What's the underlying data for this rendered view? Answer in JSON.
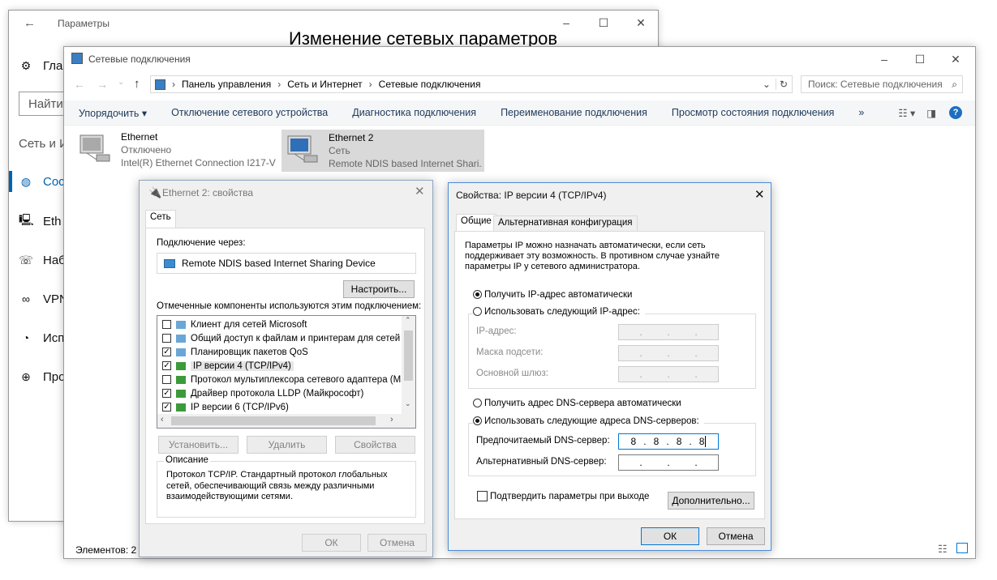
{
  "settings": {
    "title": "Параметры",
    "heading": "Изменение сетевых параметров",
    "home_label": "Гла",
    "search_placeholder": "Найти",
    "section": "Сеть и И",
    "items": [
      {
        "label": "Сос",
        "icon": "globe-icon",
        "active": true
      },
      {
        "label": "Eth",
        "icon": "ethernet-icon"
      },
      {
        "label": "Наб",
        "icon": "dialup-icon"
      },
      {
        "label": "VPN",
        "icon": "vpn-icon"
      },
      {
        "label": "Исп",
        "icon": "data-usage-icon"
      },
      {
        "label": "Про",
        "icon": "proxy-icon"
      }
    ]
  },
  "netconn": {
    "title": "Сетевые подключения",
    "breadcrumb": [
      "Панель управления",
      "Сеть и Интернет",
      "Сетевые подключения"
    ],
    "search_placeholder": "Поиск: Сетевые подключения",
    "commands": [
      "Упорядочить ▾",
      "Отключение сетевого устройства",
      "Диагностика подключения",
      "Переименование подключения",
      "Просмотр состояния подключения",
      "»"
    ],
    "adapters": [
      {
        "name": "Ethernet",
        "status": "Отключено",
        "device": "Intel(R) Ethernet Connection I217-V",
        "selected": false
      },
      {
        "name": "Ethernet 2",
        "status": "Сеть",
        "device": "Remote NDIS based Internet Shari...",
        "selected": true
      }
    ],
    "status_bar": "Элементов: 2"
  },
  "props": {
    "title": "Ethernet 2: свойства",
    "tab": "Сеть",
    "connect_via_label": "Подключение через:",
    "device": "Remote NDIS based Internet Sharing Device",
    "configure_button": "Настроить...",
    "components_label": "Отмеченные компоненты используются этим подключением:",
    "components": [
      {
        "label": "Клиент для сетей Microsoft",
        "checked": false
      },
      {
        "label": "Общий доступ к файлам и принтерам для сетей Mi",
        "checked": false
      },
      {
        "label": "Планировщик пакетов QoS",
        "checked": true
      },
      {
        "label": "IP версии 4 (TCP/IPv4)",
        "checked": true,
        "selected": true
      },
      {
        "label": "Протокол мультиплексора сетевого адаптера (Май",
        "checked": false
      },
      {
        "label": "Драйвер протокола LLDP (Майкрософт)",
        "checked": true
      },
      {
        "label": "IP версии 6 (TCP/IPv6)",
        "checked": true
      }
    ],
    "install_button": "Установить...",
    "remove_button": "Удалить",
    "properties_button": "Свойства",
    "description_label": "Описание",
    "description": "Протокол TCP/IP. Стандартный протокол глобальных сетей, обеспечивающий связь между различными взаимодействующими сетями.",
    "ok_button": "ОК",
    "cancel_button": "Отмена"
  },
  "ipv4": {
    "title": "Свойства: IP версии 4 (TCP/IPv4)",
    "tab_general": "Общие",
    "tab_alt": "Альтернативная конфигурация",
    "intro": "Параметры IP можно назначать автоматически, если сеть поддерживает эту возможность. В противном случае узнайте параметры IP у сетевого администратора.",
    "radio_auto_ip": "Получить IP-адрес автоматически",
    "radio_manual_ip": "Использовать следующий IP-адрес:",
    "ip_label": "IP-адрес:",
    "mask_label": "Маска подсети:",
    "gateway_label": "Основной шлюз:",
    "radio_auto_dns": "Получить адрес DNS-сервера автоматически",
    "radio_manual_dns": "Использовать следующие адреса DNS-серверов:",
    "preferred_dns_label": "Предпочитаемый DNS-сервер:",
    "preferred_dns": [
      "8",
      "8",
      "8",
      "8"
    ],
    "alternate_dns_label": "Альтернативный DNS-сервер:",
    "validate_label": "Подтвердить параметры при выходе",
    "advanced_button": "Дополнительно...",
    "ok_button": "ОК",
    "cancel_button": "Отмена"
  }
}
